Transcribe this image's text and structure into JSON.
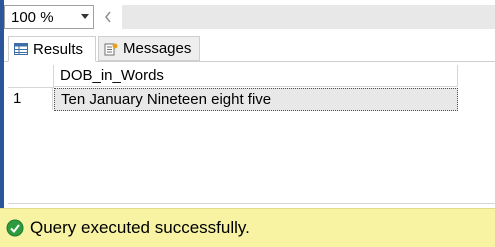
{
  "zoom": {
    "value": "100 %"
  },
  "tabs": [
    {
      "label": "Results",
      "icon": "grid-icon",
      "active": true
    },
    {
      "label": "Messages",
      "icon": "messages-icon",
      "active": false
    }
  ],
  "grid": {
    "columns": [
      "DOB_in_Words"
    ],
    "rows": [
      {
        "num": "1",
        "cells": [
          "Ten January Nineteen eight five"
        ]
      }
    ]
  },
  "status": {
    "text": "Query executed successfully.",
    "icon": "check-circle-icon",
    "color": "#f7f3a3"
  }
}
